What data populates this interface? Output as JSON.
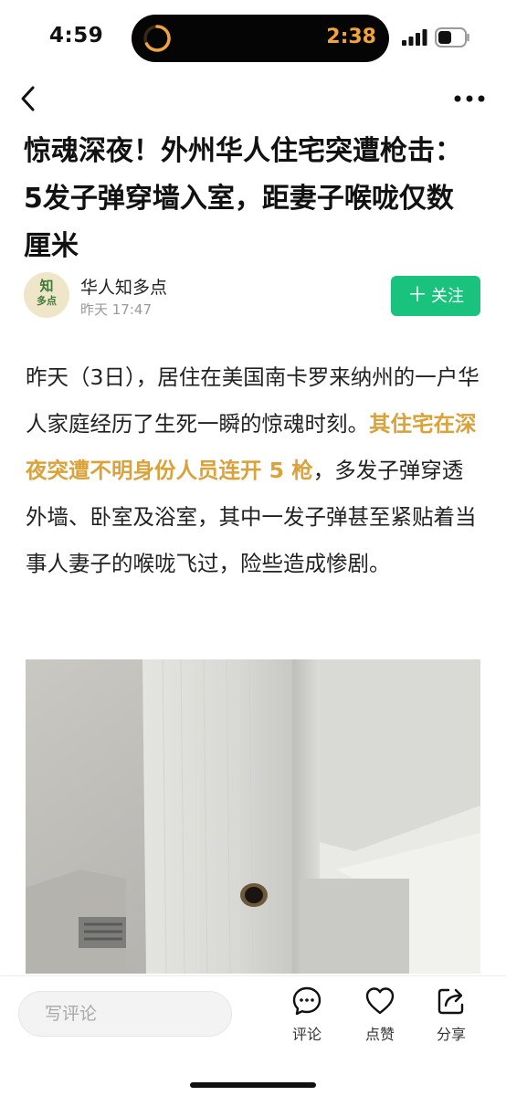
{
  "status_bar": {
    "time": "4:59",
    "timer": "2:38",
    "icons": [
      "timer-icon",
      "signal-icon",
      "battery-icon"
    ]
  },
  "nav": {
    "back_icon": "chevron-left-icon",
    "more_icon": "more-horizontal-icon"
  },
  "article": {
    "title": "惊魂深夜！外州华人住宅突遭枪击：5发子弹穿墙入室，距妻子喉咙仅数厘米",
    "author": {
      "avatar_line1": "知",
      "avatar_line2": "多点",
      "name": "华人知多点",
      "time": "昨天 17:47",
      "follow_label": "关注",
      "follow_icon": "＋"
    },
    "body": {
      "part1": "昨天（3日），居住在美国南卡罗来纳州的一户华人家庭经历了生死一瞬的惊魂时刻。",
      "highlight": "其住宅在深夜突遭不明身份人员连开 5 枪",
      "part2": "，多发子弹穿透外墙、卧室及浴室，其中一发子弹甚至紧贴着当事人妻子的喉咙飞过，险些造成惨剧。"
    }
  },
  "bottom_bar": {
    "comment_placeholder": "写评论",
    "actions": [
      {
        "label": "评论",
        "icon": "comment-icon"
      },
      {
        "label": "点赞",
        "icon": "heart-icon"
      },
      {
        "label": "分享",
        "icon": "share-icon"
      }
    ]
  },
  "colors": {
    "accent_green": "#19c37d",
    "highlight_gold": "#d9a23b",
    "timer_orange": "#f2a33a"
  }
}
